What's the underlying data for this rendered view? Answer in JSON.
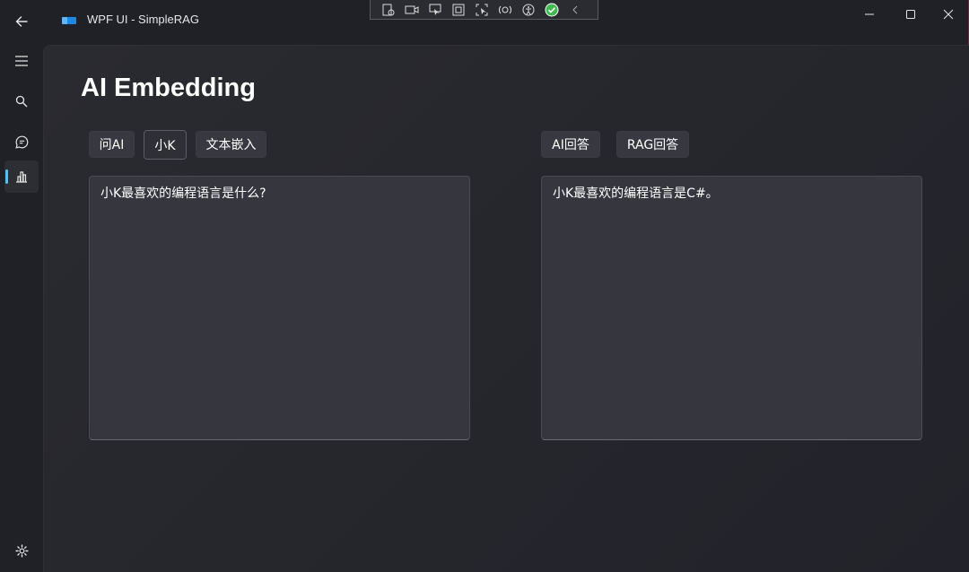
{
  "window": {
    "title": "WPF UI - SimpleRAG"
  },
  "page": {
    "title": "AI Embedding"
  },
  "left_toolbar": {
    "buttons": [
      {
        "label": "问AI",
        "selected": false
      },
      {
        "label": "小K",
        "selected": true
      },
      {
        "label": "文本嵌入",
        "selected": false
      }
    ]
  },
  "right_toolbar": {
    "buttons": [
      {
        "label": "AI回答",
        "selected": false
      },
      {
        "label": "RAG回答",
        "selected": false
      }
    ]
  },
  "question_box": {
    "value": "小K最喜欢的编程语言是什么?"
  },
  "answer_box": {
    "value": "小K最喜欢的编程语言是C#。"
  },
  "sidebar": {
    "items": [
      {
        "icon": "hamburger-menu-icon"
      },
      {
        "icon": "search-icon"
      },
      {
        "icon": "chat-icon"
      },
      {
        "icon": "bar-chart-icon",
        "active": true
      }
    ],
    "footer_icon": "settings-gear-icon"
  },
  "colors": {
    "accent": "#4cc2ff",
    "background": "#202127",
    "control": "#383940"
  }
}
